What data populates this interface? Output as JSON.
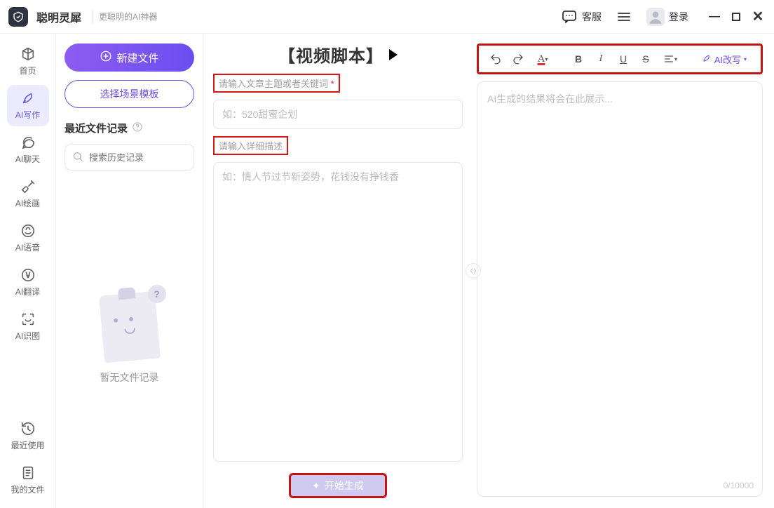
{
  "app": {
    "title": "聪明灵犀",
    "subtitle": "更聪明的AI神器"
  },
  "titlebar": {
    "support_label": "客服",
    "login_label": "登录"
  },
  "nav": [
    {
      "label": "首页",
      "icon": "home"
    },
    {
      "label": "AI写作",
      "icon": "pen",
      "active": true
    },
    {
      "label": "AI聊天",
      "icon": "chat"
    },
    {
      "label": "AI绘画",
      "icon": "paint"
    },
    {
      "label": "AI语音",
      "icon": "voice"
    },
    {
      "label": "AI翻译",
      "icon": "translate"
    },
    {
      "label": "AI识图",
      "icon": "scan"
    }
  ],
  "nav_bottom": [
    {
      "label": "最近使用",
      "icon": "history"
    },
    {
      "label": "我的文件",
      "icon": "doc"
    }
  ],
  "filepanel": {
    "new_file": "新建文件",
    "choose_template": "选择场景模板",
    "recent_label": "最近文件记录",
    "search_placeholder": "搜索历史记录",
    "empty_text": "暂无文件记录"
  },
  "editor": {
    "header_title": "【视频脚本】",
    "label_topic": "请输入文章主题或者关键词",
    "topic_required": "*",
    "placeholder_topic": "如：520甜蜜企划",
    "label_detail": "请输入详细描述",
    "placeholder_detail": "如：情人节过节新姿势，花钱没有挣钱香",
    "generate_label": "开始生成"
  },
  "output": {
    "placeholder": "AI生成的结果将会在此展示...",
    "ai_rewrite": "AI改写",
    "counter": "0/10000"
  }
}
